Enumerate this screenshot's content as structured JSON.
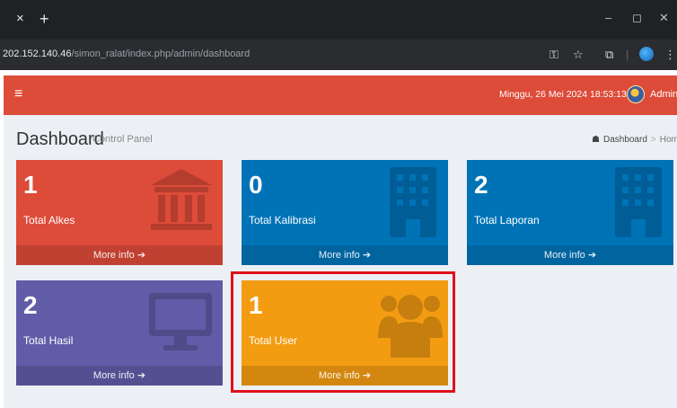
{
  "browser": {
    "close_tab": "×",
    "new_tab": "+",
    "url_host": "202.152.140.46",
    "url_path": "/simon_ralat/index.php/admin/dashboard"
  },
  "header": {
    "menu_icon": "hamburger-icon",
    "datetime": "Minggu, 26 Mei 2024 18:53:13",
    "user": "Admin"
  },
  "page": {
    "title": "Dashboard",
    "subtitle": "Control Panel",
    "breadcrumb": [
      "Dashboard",
      "Home"
    ]
  },
  "boxes": [
    {
      "value": "1",
      "label": "Total Alkes",
      "more": "More info",
      "color": "#dd4b39",
      "icon": "bank-icon"
    },
    {
      "value": "0",
      "label": "Total Kalibrasi",
      "more": "More info",
      "color": "#0073b7",
      "icon": "building-icon"
    },
    {
      "value": "2",
      "label": "Total Laporan",
      "more": "More info",
      "color": "#0073b7",
      "icon": "building-icon"
    },
    {
      "value": "2",
      "label": "Total Hasil",
      "more": "More info",
      "color": "#605ca8",
      "icon": "desktop-icon"
    },
    {
      "value": "1",
      "label": "Total User",
      "more": "More info",
      "color": "#f39c12",
      "icon": "users-icon"
    }
  ],
  "highlight_color": "#e0101a"
}
